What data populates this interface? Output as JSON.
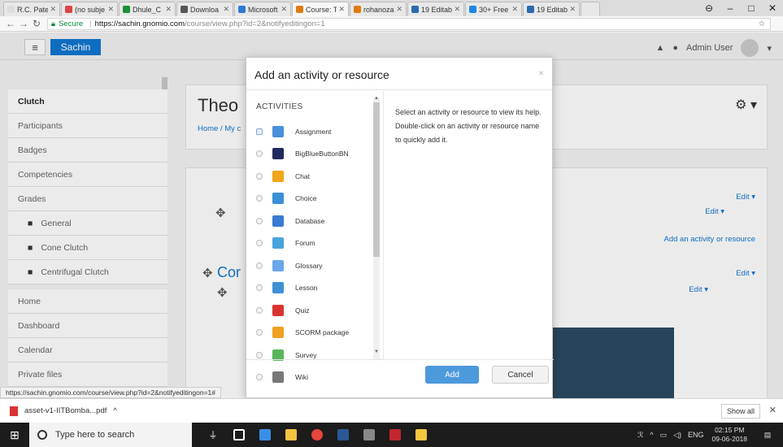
{
  "browser": {
    "tabs": [
      {
        "label": "R.C. Patel",
        "color": "#ddd",
        "active": false
      },
      {
        "label": "(no subje",
        "color": "#d44",
        "active": false
      },
      {
        "label": "Dhule_C",
        "color": "#1a8f3c",
        "active": false
      },
      {
        "label": "Downloa",
        "color": "#555",
        "active": false
      },
      {
        "label": "Microsoft",
        "color": "#2b7bd6",
        "active": false
      },
      {
        "label": "Course: T",
        "color": "#e07a10",
        "active": true
      },
      {
        "label": "rohanoza",
        "color": "#e07a10",
        "active": false
      },
      {
        "label": "19 Editab",
        "color": "#2a6bb0",
        "active": false
      },
      {
        "label": "30+ Free",
        "color": "#1e88e5",
        "active": false
      },
      {
        "label": "19 Editab",
        "color": "#2a6bb0",
        "active": false
      }
    ],
    "secure_label": "Secure",
    "url_host": "https://sachin.gnomio.com",
    "url_path": "/course/view.php?id=2&notifyeditingon=1"
  },
  "navbar": {
    "brand": "Sachin",
    "user": "Admin User"
  },
  "drawer": {
    "items": [
      {
        "label": "Clutch",
        "kind": "head"
      },
      {
        "label": "Participants",
        "kind": "item"
      },
      {
        "label": "Badges",
        "kind": "item"
      },
      {
        "label": "Competencies",
        "kind": "item"
      },
      {
        "label": "Grades",
        "kind": "item"
      },
      {
        "label": "General",
        "kind": "sub"
      },
      {
        "label": "Cone Clutch",
        "kind": "sub"
      },
      {
        "label": "Centrifugal Clutch",
        "kind": "sub"
      },
      {
        "label": "",
        "kind": "gap"
      },
      {
        "label": "Home",
        "kind": "item"
      },
      {
        "label": "Dashboard",
        "kind": "item"
      },
      {
        "label": "Calendar",
        "kind": "item"
      },
      {
        "label": "Private files",
        "kind": "item"
      }
    ]
  },
  "course": {
    "title": "Theo",
    "breadcrumb": "Home / My c",
    "edit1": "Edit ▾",
    "edit2": "Edit ▾",
    "edit3": "Edit ▾",
    "edit4": "Edit ▾",
    "add_activity": "Add an activity or resource",
    "section2": "Cor"
  },
  "modal": {
    "title": "Add an activity or resource",
    "close": "×",
    "activities_header": "ACTIVITIES",
    "help_text": "Select an activity or resource to view its help. Double-click on an activity or resource name to quickly add it.",
    "add_label": "Add",
    "cancel_label": "Cancel",
    "activities": [
      {
        "label": "Assignment",
        "icon": "assignment-icon",
        "color": "#4a90d9"
      },
      {
        "label": "BigBlueButtonBN",
        "icon": "bigbluebutton-icon",
        "color": "#1d2a5b"
      },
      {
        "label": "Chat",
        "icon": "chat-icon",
        "color": "#f2a51a"
      },
      {
        "label": "Choice",
        "icon": "choice-icon",
        "color": "#3a8fd6"
      },
      {
        "label": "Database",
        "icon": "database-icon",
        "color": "#3a7bd5"
      },
      {
        "label": "Forum",
        "icon": "forum-icon",
        "color": "#4aa3df"
      },
      {
        "label": "Glossary",
        "icon": "glossary-icon",
        "color": "#6aa6e8"
      },
      {
        "label": "Lesson",
        "icon": "lesson-icon",
        "color": "#3f8fd4"
      },
      {
        "label": "Quiz",
        "icon": "quiz-icon",
        "color": "#d9332f"
      },
      {
        "label": "SCORM package",
        "icon": "scorm-icon",
        "color": "#f0a020"
      },
      {
        "label": "Survey",
        "icon": "survey-icon",
        "color": "#5ab55a"
      },
      {
        "label": "Wiki",
        "icon": "wiki-icon",
        "color": "#777777"
      }
    ]
  },
  "status_url": "https://sachin.gnomio.com/course/view.php?id=2&notifyeditingon=1#",
  "downloads": {
    "file": "asset-v1-IITBomba...pdf",
    "show_all": "Show all"
  },
  "taskbar": {
    "search_placeholder": "Type here to search",
    "lang": "ENG",
    "time": "02:15 PM",
    "date": "09-06-2018"
  }
}
